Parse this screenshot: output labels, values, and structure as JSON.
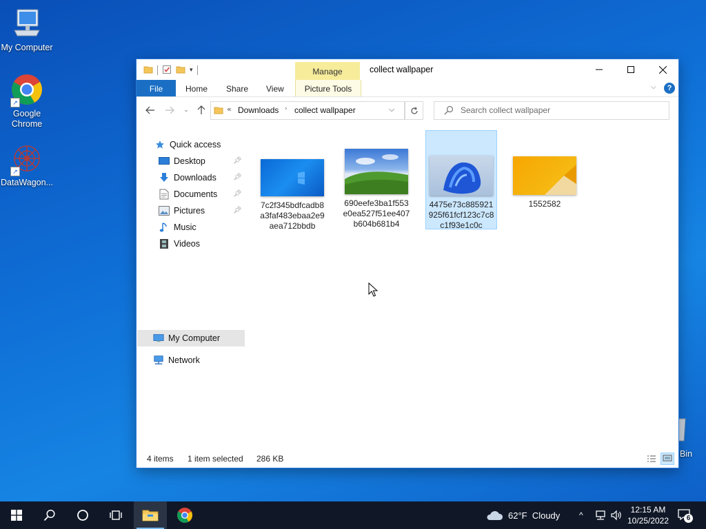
{
  "desktop": {
    "icons": [
      {
        "label": "My Computer"
      },
      {
        "label": "Google Chrome"
      },
      {
        "label": "DataWagon..."
      }
    ],
    "recycle_bin_label": "Bin"
  },
  "window": {
    "title": "collect wallpaper",
    "manage_tab": "Manage",
    "ribbon": {
      "file": "File",
      "home": "Home",
      "share": "Share",
      "view": "View",
      "picture_tools": "Picture Tools"
    },
    "address": {
      "prefix": "«",
      "crumbs": [
        "Downloads",
        "collect wallpaper"
      ]
    },
    "search": {
      "placeholder": "Search collect wallpaper"
    },
    "nav": {
      "quick_access": "Quick access",
      "items": [
        "Desktop",
        "Downloads",
        "Documents",
        "Pictures",
        "Music",
        "Videos"
      ],
      "my_computer": "My Computer",
      "network": "Network"
    },
    "files": [
      {
        "name": "7c2f345bdfcadb8a3faf483ebaa2e9aea712bbdb",
        "selected": false
      },
      {
        "name": "690eefe3ba1f553e0ea527f51ee407b604b681b4",
        "selected": false
      },
      {
        "name": "4475e73c885921925f61fcf123c7c8c1f93e1c0c",
        "selected": true
      },
      {
        "name": "1552582",
        "selected": false
      }
    ],
    "status": {
      "items": "4 items",
      "selected": "1 item selected",
      "size": "286 KB"
    }
  },
  "taskbar": {
    "weather": "62°F  Cloudy",
    "time": "12:15 AM",
    "date": "10/25/2022",
    "notifications": "6"
  },
  "colors": {
    "accent": "#1a6fc4",
    "selection": "#cce8ff",
    "manage_tab": "#f6ec9a",
    "taskbar": "#101828"
  }
}
